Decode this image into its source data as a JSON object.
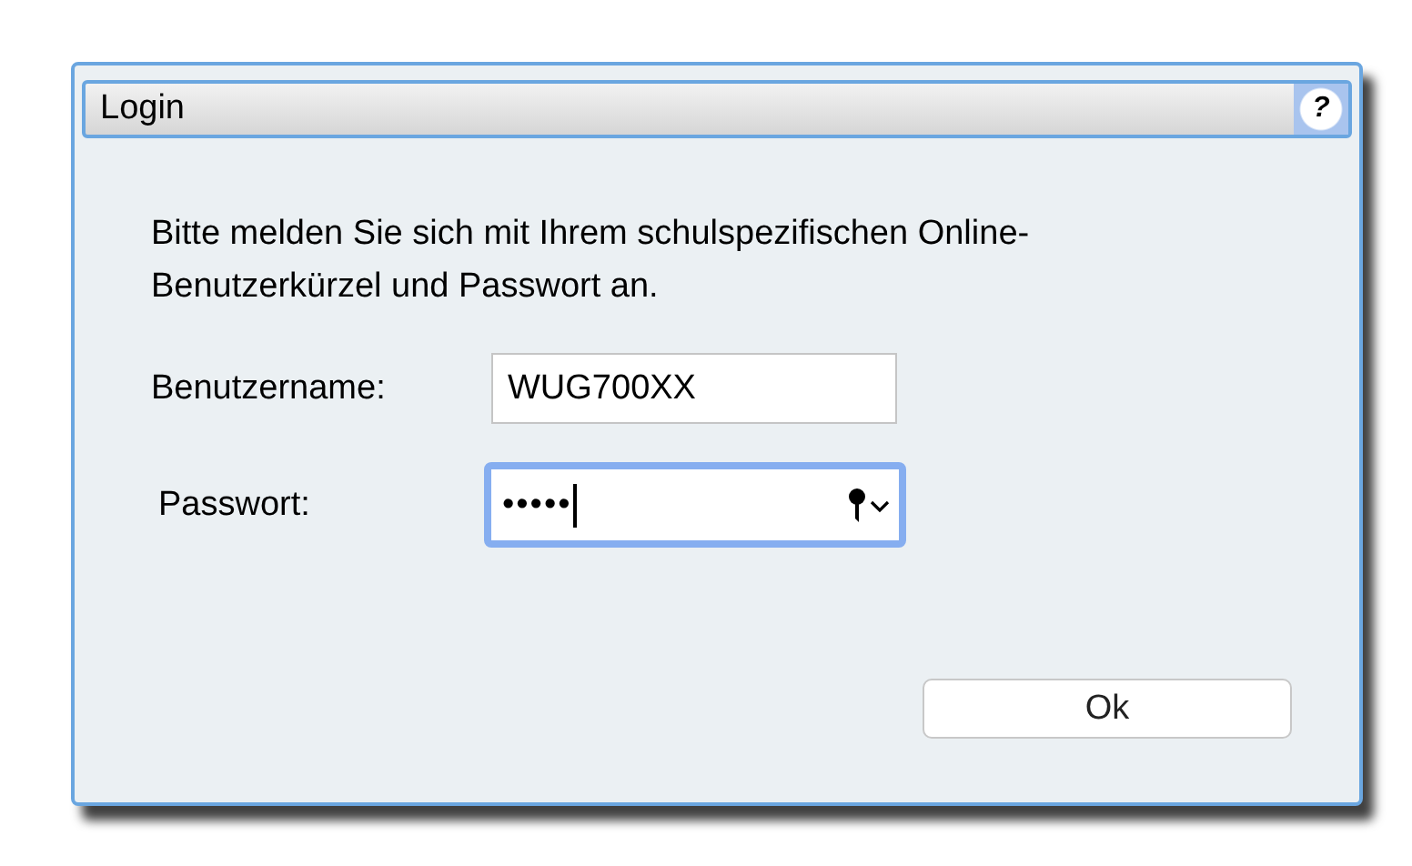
{
  "dialog": {
    "title": "Login",
    "help_button": "?"
  },
  "message": "Bitte melden Sie sich mit Ihrem schulspezifischen Online-Benutzerkürzel und Passwort an.",
  "fields": [
    {
      "label": "Benutzername:",
      "value": "WUG700XX",
      "kind": "text",
      "focused": false
    },
    {
      "label": "Passwort:",
      "value": "•••••",
      "kind": "password",
      "focused": true
    }
  ],
  "buttons": [
    "Ok"
  ]
}
